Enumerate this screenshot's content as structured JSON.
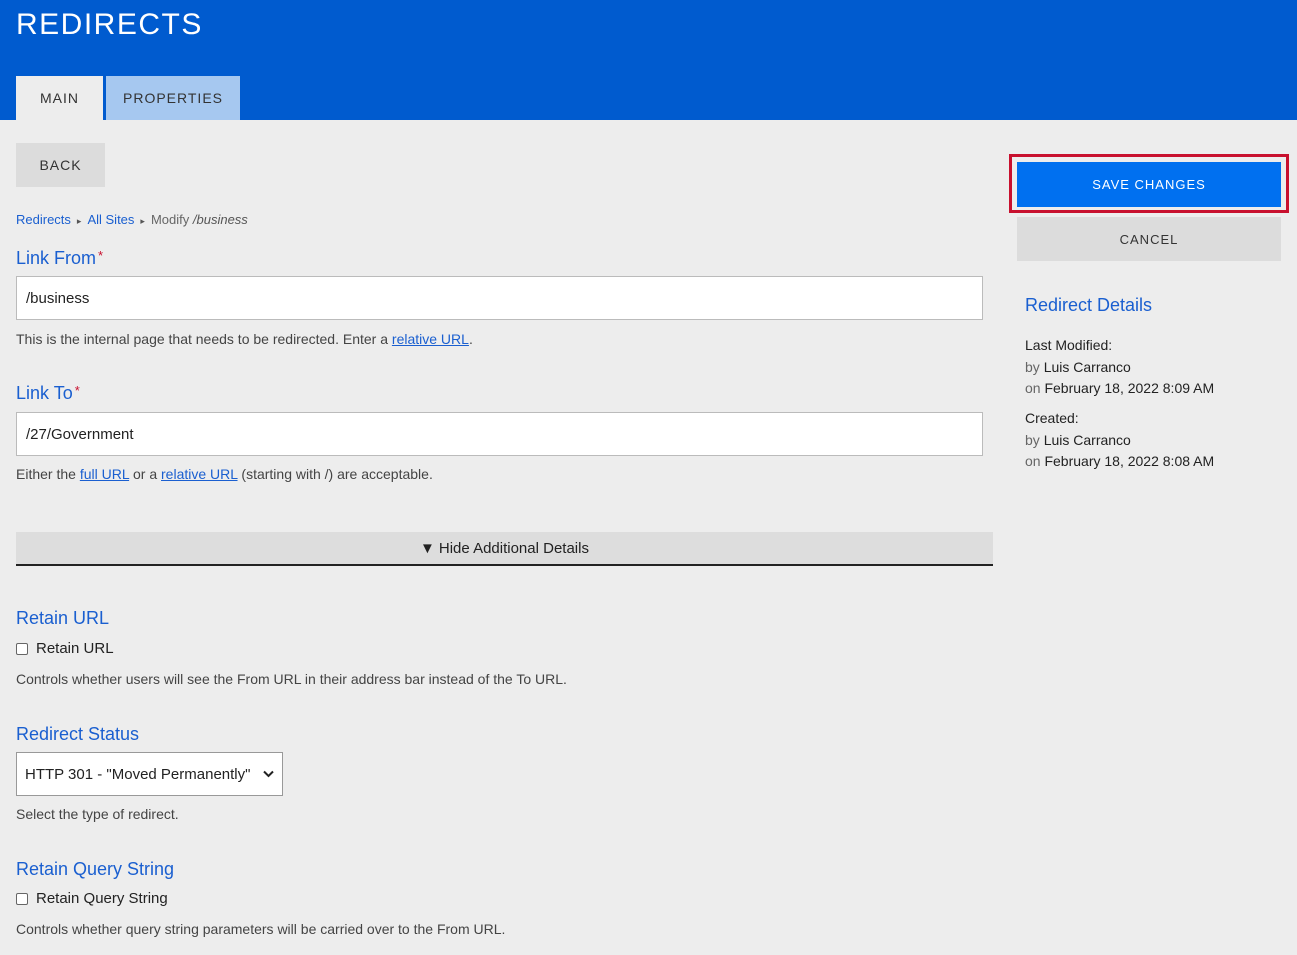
{
  "header": {
    "title": "REDIRECTS"
  },
  "tabs": [
    {
      "label": "MAIN"
    },
    {
      "label": "PROPERTIES"
    }
  ],
  "actions": {
    "back": "BACK",
    "save": "SAVE CHANGES",
    "cancel": "CANCEL"
  },
  "breadcrumb": {
    "item1": "Redirects",
    "item2": "All Sites",
    "current_prefix": "Modify",
    "current_path": "/business"
  },
  "link_from": {
    "label": "Link From",
    "required": "*",
    "value": "/business",
    "help_before": "This is the internal page that needs to be redirected. Enter a ",
    "help_link": "relative URL",
    "help_after": "."
  },
  "link_to": {
    "label": "Link To",
    "required": "*",
    "value": "/27/Government",
    "help_before": "Either the ",
    "help_link1": "full URL",
    "help_mid": " or a ",
    "help_link2": "relative URL",
    "help_after": " (starting with /) are acceptable."
  },
  "details_toggle": {
    "icon": "▼",
    "label": "Hide Additional Details"
  },
  "retain_url": {
    "heading": "Retain URL",
    "checkbox_label": "Retain URL",
    "checked": false,
    "help": "Controls whether users will see the From URL in their address bar instead of the To URL."
  },
  "redirect_status": {
    "heading": "Redirect Status",
    "selected": "HTTP 301 - \"Moved Permanently\"",
    "help": "Select the type of redirect."
  },
  "retain_query": {
    "heading": "Retain Query String",
    "checkbox_label": "Retain Query String",
    "checked": false,
    "help": "Controls whether query string parameters will be carried over to the From URL."
  },
  "redirect_details": {
    "title": "Redirect Details",
    "last_modified_label": "Last Modified:",
    "last_modified_by_prefix": "by",
    "last_modified_by": "Luis Carranco",
    "last_modified_on_prefix": "on",
    "last_modified_on": "February 18, 2022 8:09 AM",
    "created_label": "Created:",
    "created_by_prefix": "by",
    "created_by": "Luis Carranco",
    "created_on_prefix": "on",
    "created_on": "February 18, 2022 8:08 AM"
  },
  "colors": {
    "header": "#005bcf",
    "accent_link": "#1a5fd0",
    "save_button": "#0070f0",
    "highlight_frame": "#c8102e",
    "background": "#ededed"
  }
}
